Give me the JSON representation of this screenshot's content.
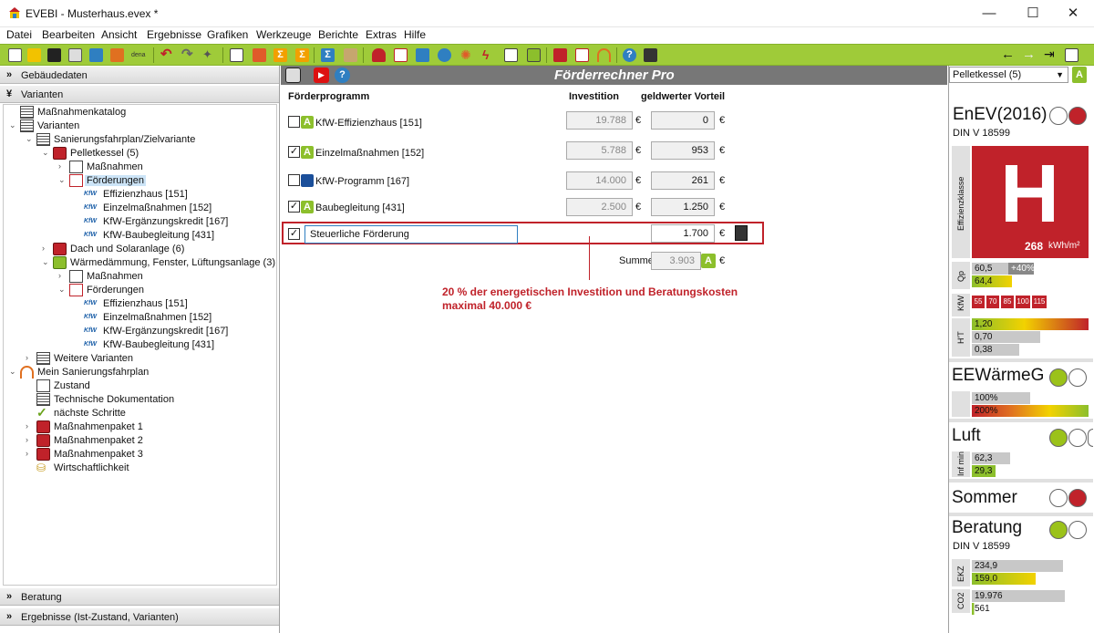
{
  "window": {
    "title": "EVEBI - Musterhaus.evex *",
    "minimize": "—",
    "maximize": "☐",
    "close": "✕"
  },
  "menu": [
    "Datei",
    "Bearbeiten",
    "Ansicht",
    "Ergebnisse",
    "Grafiken",
    "Werkzeuge",
    "Berichte",
    "Extras",
    "Hilfe"
  ],
  "sections": {
    "gebaeudedaten": "Gebäudedaten",
    "varianten": "Varianten",
    "beratung": "Beratung",
    "ergebnisse": "Ergebnisse (Ist-Zustand, Varianten)"
  },
  "tree": {
    "n0": "Maßnahmenkatalog",
    "n1": "Varianten",
    "n2": "Sanierungsfahrplan/Zielvariante",
    "n3": "Pelletkessel (5)",
    "n4": "Maßnahmen",
    "n5": "Förderungen",
    "n6": "Effizienzhaus [151]",
    "n7": "Einzelmaßnahmen [152]",
    "n8": "KfW-Ergänzungskredit [167]",
    "n9": "KfW-Baubegleitung [431]",
    "n10": "Dach und Solaranlage (6)",
    "n11": "Wärmedämmung, Fenster, Lüftungsanlage (3)",
    "n12": "Maßnahmen",
    "n13": "Förderungen",
    "n14": "Effizienzhaus [151]",
    "n15": "Einzelmaßnahmen [152]",
    "n16": "KfW-Ergänzungskredit [167]",
    "n17": "KfW-Baubegleitung [431]",
    "n18": "Weitere Varianten",
    "n19": "Mein Sanierungsfahrplan",
    "n20": "Zustand",
    "n21": "Technische Dokumentation",
    "n22": "nächste Schritte",
    "n23": "Maßnahmenpaket 1",
    "n24": "Maßnahmenpaket 2",
    "n25": "Maßnahmenpaket 3",
    "n26": "Wirtschaftlichkeit",
    "kfw": "KfW"
  },
  "main": {
    "title": "Förderrechner Pro",
    "col_program": "Förderprogramm",
    "col_investition": "Investition",
    "col_vorteil": "geldwerter Vorteil",
    "currency": "€",
    "rows": [
      {
        "label": "KfW-Effizienzhaus [151]",
        "invest": "19.788",
        "vorteil": "0",
        "badge": "A",
        "checked": ""
      },
      {
        "label": "Einzelmaßnahmen [152]",
        "invest": "5.788",
        "vorteil": "953",
        "badge": "A",
        "checked": "✓"
      },
      {
        "label": "KfW-Programm [167]",
        "invest": "14.000",
        "vorteil": "261",
        "badge": "",
        "checked": ""
      },
      {
        "label": "Baubegleitung [431]",
        "invest": "2.500",
        "vorteil": "1.250",
        "badge": "A",
        "checked": "✓"
      }
    ],
    "steuer": {
      "label": "Steuerliche Förderung",
      "vorteil": "1.700",
      "checked": "✓"
    },
    "summe_label": "Summe",
    "summe_value": "3.903",
    "summe_badge": "A",
    "note_line1": "20 % der energetischen Investition und Beratungskosten",
    "note_line2": "maximal 40.000 €"
  },
  "right": {
    "dropdown": "Pelletkessel (5)",
    "dropdown_badge": "A",
    "enev": {
      "title": "EnEV(2016)",
      "sub": "DIN V 18599",
      "klasse_label": "Effizienzklasse",
      "klasse": "H",
      "value": "268",
      "unit": "kWh/m²",
      "qp_label": "Qp",
      "qp1": "60,5",
      "qp_pct": "+40%",
      "qp2": "64,4",
      "kfw_label": "KfW",
      "kfw_levels": [
        "55",
        "70",
        "85",
        "100",
        "115"
      ],
      "ht_label": "H'T",
      "ht1": "1,20",
      "ht2": "0,70",
      "ht3": "0,38"
    },
    "ee": {
      "title": "EEWärmeG",
      "v1": "100%",
      "v2": "200%"
    },
    "luft": {
      "title": "Luft",
      "label": "Inf min",
      "v1": "62,3",
      "v2": "29,3"
    },
    "sommer": {
      "title": "Sommer"
    },
    "beratung": {
      "title": "Beratung",
      "sub": "DIN V 18599",
      "ekz_label": "EKZ",
      "ekz1": "234,9",
      "ekz2": "159,0",
      "co2_label": "CO2",
      "co2_1": "19.976",
      "co2_2": "561"
    }
  }
}
